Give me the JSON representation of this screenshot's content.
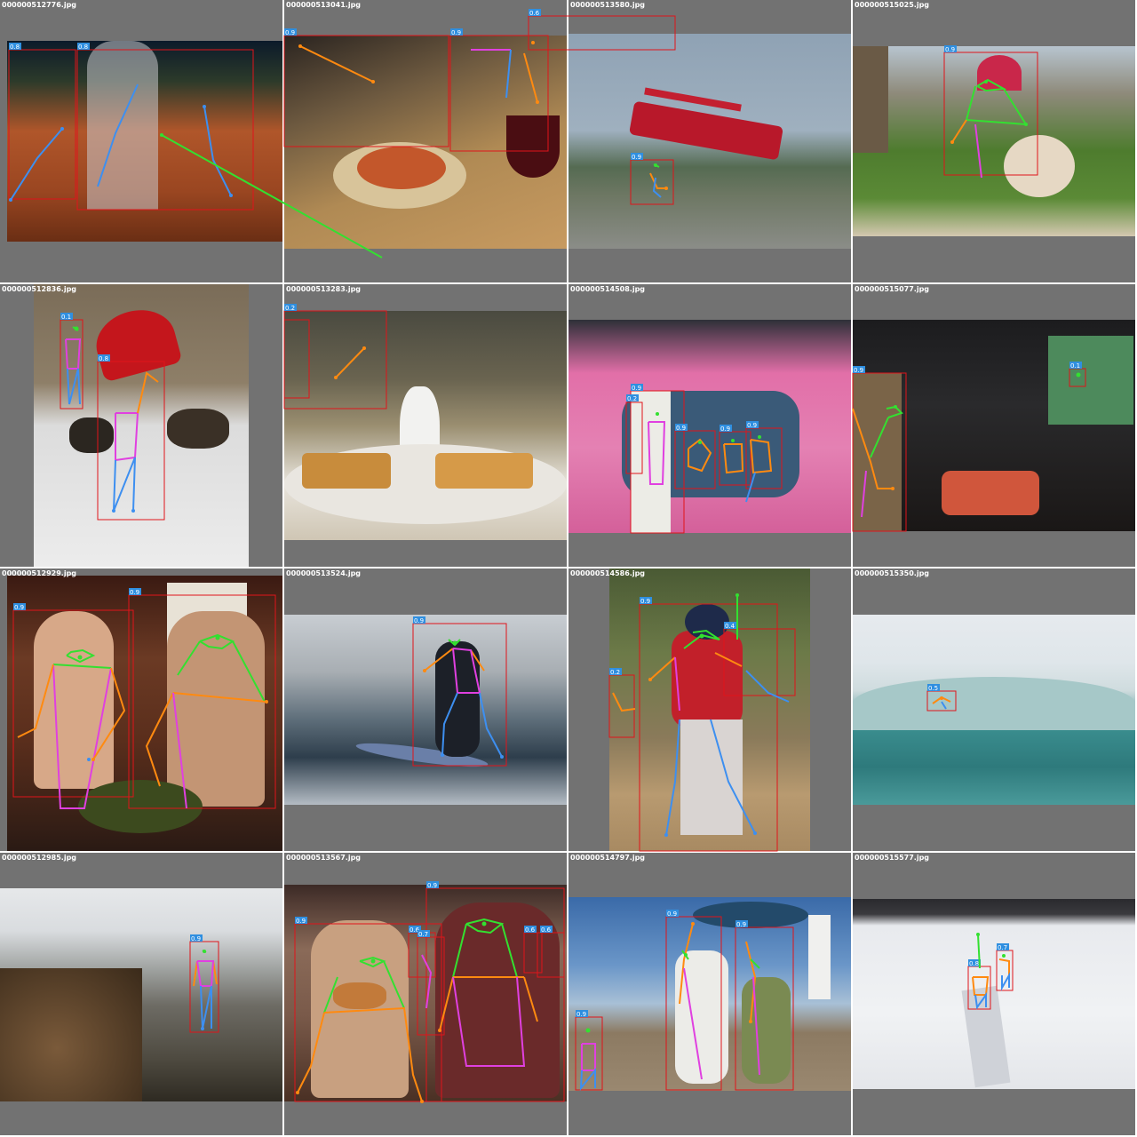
{
  "tiles": [
    {
      "filename": "000000512776.jpg",
      "labels": [
        "0.8",
        "0.8"
      ]
    },
    {
      "filename": "000000513041.jpg",
      "labels": [
        "0.9",
        "0.9",
        "0.6"
      ]
    },
    {
      "filename": "000000513580.jpg",
      "labels": [
        "0.9"
      ]
    },
    {
      "filename": "000000515025.jpg",
      "labels": [
        "0.9"
      ]
    },
    {
      "filename": "000000512836.jpg",
      "labels": [
        "0.1",
        "0.8"
      ]
    },
    {
      "filename": "000000513283.jpg",
      "labels": [
        "0.2"
      ]
    },
    {
      "filename": "000000514508.jpg",
      "labels": [
        "0.9",
        "0.2",
        "0.9",
        "0.9",
        "0.9"
      ]
    },
    {
      "filename": "000000515077.jpg",
      "labels": [
        "0.9",
        "0.1"
      ]
    },
    {
      "filename": "000000512929.jpg",
      "labels": [
        "0.9",
        "0.9"
      ]
    },
    {
      "filename": "000000513524.jpg",
      "labels": [
        "0.9"
      ]
    },
    {
      "filename": "000000514586.jpg",
      "labels": [
        "0.9",
        "0.2",
        "0.4"
      ]
    },
    {
      "filename": "000000515350.jpg",
      "labels": [
        "0.5"
      ]
    },
    {
      "filename": "000000512985.jpg",
      "labels": [
        "0.9"
      ]
    },
    {
      "filename": "000000513567.jpg",
      "labels": [
        "0.9",
        "0.9",
        "0.6",
        "0.7",
        "0.6",
        "0.6"
      ]
    },
    {
      "filename": "000000514797.jpg",
      "labels": [
        "0.9",
        "0.9",
        "0.9"
      ]
    },
    {
      "filename": "000000515577.jpg",
      "labels": [
        "0.8",
        "0.7"
      ]
    }
  ],
  "colors": {
    "tile_background": "#727272",
    "bbox": "#e0141a",
    "score_tag": "#2f8fe0",
    "limb_head": "#33e030",
    "limb_arm": "#ff8a10",
    "limb_leg": "#3d8ff0",
    "limb_torso": "#e040e0"
  }
}
